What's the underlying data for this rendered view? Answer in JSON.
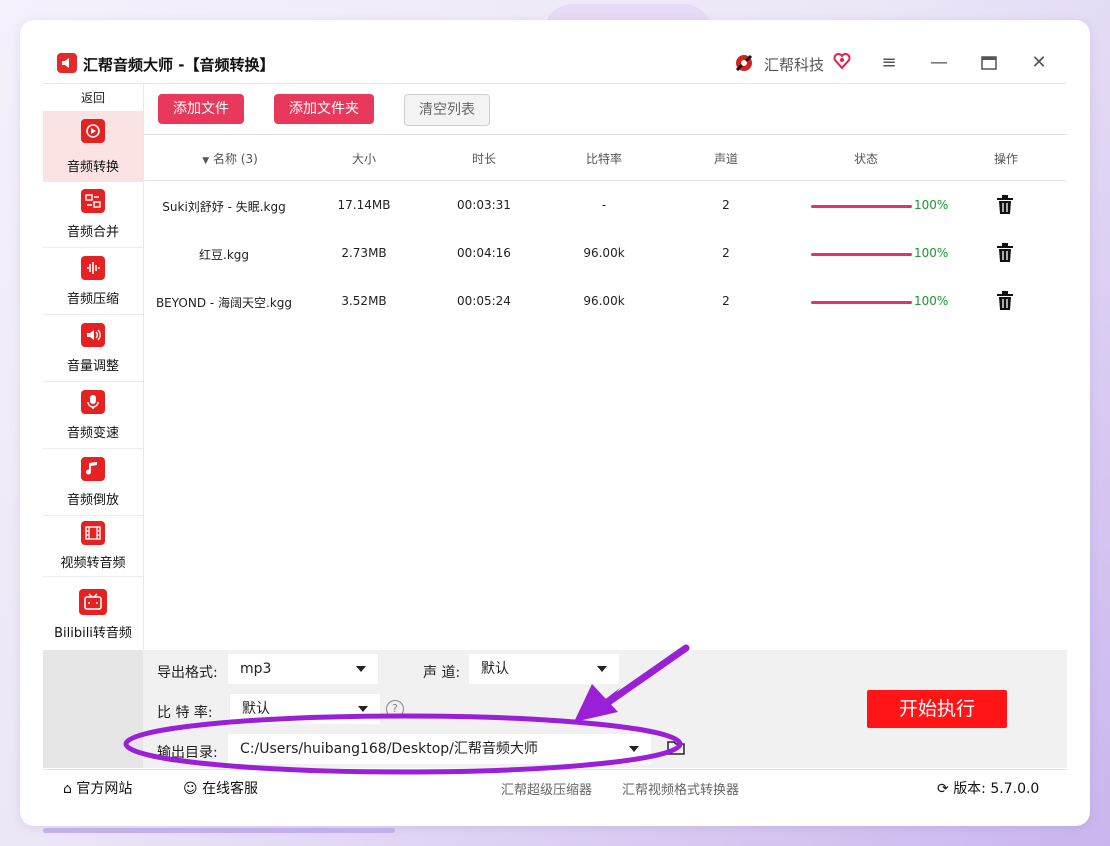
{
  "window": {
    "app_title": "汇帮音频大师  -【音频转换】",
    "brand": "汇帮科技"
  },
  "sidebar": {
    "back": "返回",
    "items": [
      {
        "label": "音频转换",
        "icon": "convert-icon",
        "active": true
      },
      {
        "label": "音频合并",
        "icon": "merge-icon"
      },
      {
        "label": "音频压缩",
        "icon": "compress-icon"
      },
      {
        "label": "音量调整",
        "icon": "volume-icon"
      },
      {
        "label": "音频变速",
        "icon": "speed-icon"
      },
      {
        "label": "音频倒放",
        "icon": "reverse-icon"
      },
      {
        "label": "视频转音频",
        "icon": "video-icon"
      },
      {
        "label": "Bilibili转音频",
        "icon": "bilibili-icon"
      }
    ]
  },
  "toolbar": {
    "add_file": "添加文件",
    "add_folder": "添加文件夹",
    "clear_list": "清空列表"
  },
  "table": {
    "headers": {
      "name": "名称 (3)",
      "size": "大小",
      "duration": "时长",
      "bitrate": "比特率",
      "channels": "声道",
      "status": "状态",
      "actions": "操作"
    },
    "rows": [
      {
        "name": "Suki刘舒妤 - 失眠.kgg",
        "size": "17.14MB",
        "duration": "00:03:31",
        "bitrate": "-",
        "channels": "2",
        "progress": 1.0,
        "progress_label": "100%"
      },
      {
        "name": "红豆.kgg",
        "size": "2.73MB",
        "duration": "00:04:16",
        "bitrate": "96.00k",
        "channels": "2",
        "progress": 1.0,
        "progress_label": "100%"
      },
      {
        "name": "BEYOND - 海阔天空.kgg",
        "size": "3.52MB",
        "duration": "00:05:24",
        "bitrate": "96.00k",
        "channels": "2",
        "progress": 1.0,
        "progress_label": "100%"
      }
    ]
  },
  "settings": {
    "format_label": "导出格式:",
    "format_value": "mp3",
    "channel_label": "声 道:",
    "channel_value": "默认",
    "bitrate_label": "比 特 率:",
    "bitrate_value": "默认",
    "help": "?",
    "output_label": "输出目录:",
    "output_value": "C:/Users/huibang168/Desktop/汇帮音频大师",
    "start": "开始执行"
  },
  "footer": {
    "website": "官方网站",
    "support": "在线客服",
    "link1": "汇帮超级压缩器",
    "link2": "汇帮视频格式转换器",
    "version": "版本: 5.7.0.0"
  },
  "colors": {
    "accent": "#e8395c",
    "start": "#ff1515",
    "annotation": "#9a1fd6",
    "progress": "#e8306a",
    "progress_text": "#1a9a2a"
  }
}
